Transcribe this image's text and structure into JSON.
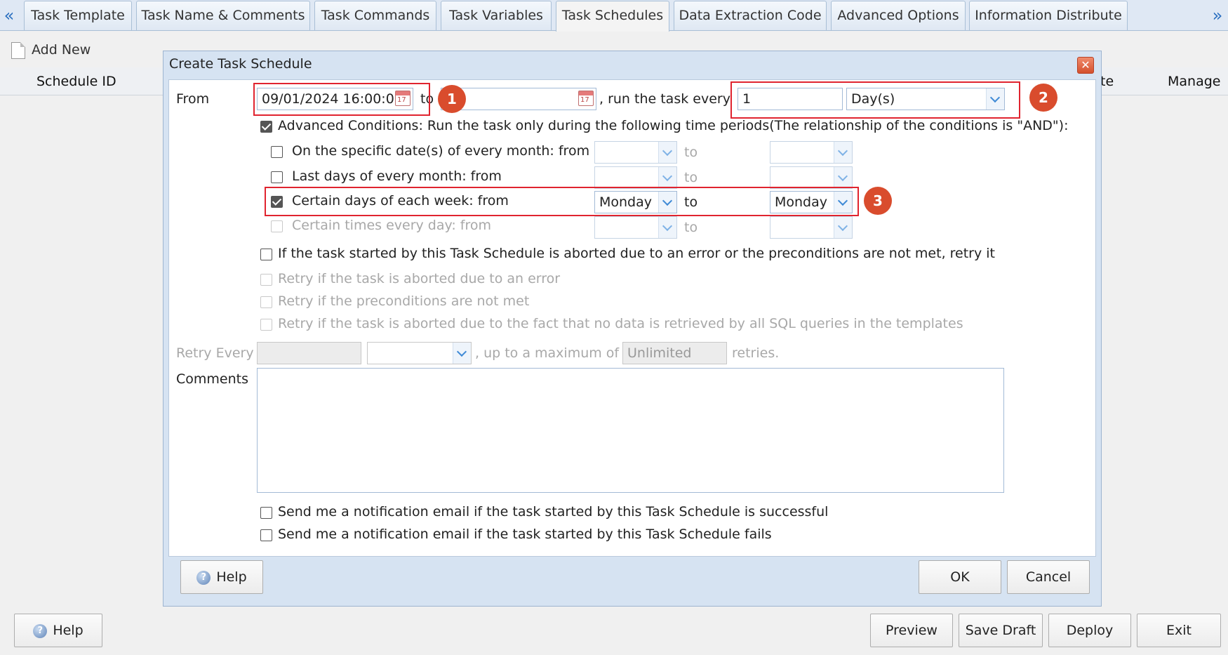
{
  "tabs": [
    "Task Template",
    "Task Name & Comments",
    "Task Commands",
    "Task Variables",
    "Task Schedules",
    "Data Extraction Code",
    "Advanced Options",
    "Information Distribute"
  ],
  "tab_arrows": {
    "left": "«",
    "right": "»"
  },
  "toolbar": {
    "add_new": "Add New"
  },
  "grid": {
    "col_schedule_id": "Schedule ID",
    "col_partial": "te",
    "col_manage": "Manage"
  },
  "footer": {
    "help": "Help",
    "preview": "Preview",
    "save_draft": "Save Draft",
    "deploy": "Deploy",
    "exit": "Exit"
  },
  "dialog": {
    "title": "Create Task Schedule",
    "close": "✕",
    "from_label": "From",
    "from_value": "09/01/2024 16:00:0",
    "to_label": "to",
    "to_value": "",
    "run_label": ", run the task every",
    "interval_value": "1",
    "interval_unit": "Day(s)",
    "advanced_label": "Advanced Conditions: Run the task only during the following time periods(The relationship of the conditions is \"AND\"):",
    "cond_specific": "On the specific date(s) of every month: from",
    "cond_lastdays": "Last days of every month: from",
    "cond_week": "Certain days of each week: from",
    "cond_times": "Certain times every day: from",
    "to": "to",
    "week_from": "Monday",
    "week_to": "Monday",
    "retry_main": "If the task started by this Task Schedule is aborted due to an error or the preconditions are not met, retry it",
    "retry_error": "Retry if the task is aborted due to an error",
    "retry_precond": "Retry if the preconditions are not met",
    "retry_nodata": "Retry if the task is aborted due to the fact that no data is retrieved by all SQL queries in the templates",
    "retry_every": "Retry Every",
    "up_to": ", up to a maximum of",
    "max_retries": "Unlimited",
    "retries": "retries.",
    "comments": "Comments",
    "notify_success": "Send me a notification email if the task started by this Task Schedule is successful",
    "notify_fail": "Send me a notification email if the task started by this Task Schedule fails",
    "help": "Help",
    "ok": "OK",
    "cancel": "Cancel"
  },
  "annotations": [
    "1",
    "2",
    "3"
  ],
  "colors": {
    "highlight": "#e0242f",
    "badge": "#d94c2d",
    "tab_bg": "#dfe8f4"
  }
}
